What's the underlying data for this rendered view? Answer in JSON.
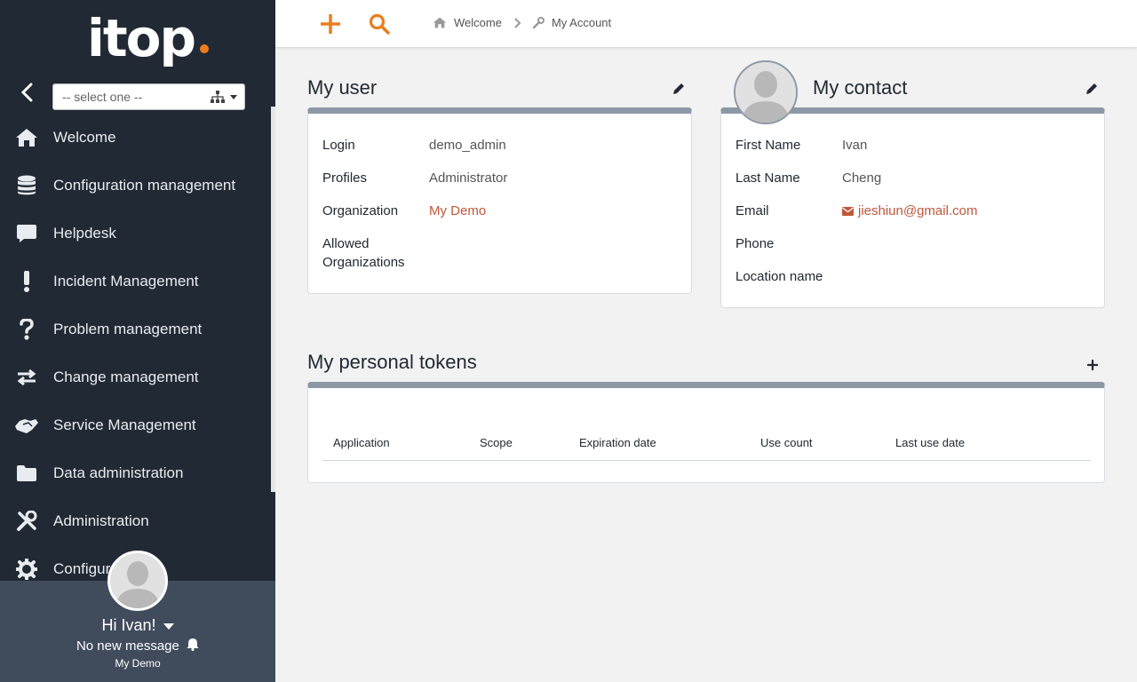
{
  "app": {
    "logo_text": "itop"
  },
  "sidebar": {
    "org_select": {
      "placeholder": "-- select one --"
    },
    "items": [
      {
        "label": "Welcome",
        "icon": "home-icon"
      },
      {
        "label": "Configuration management",
        "icon": "database-icon"
      },
      {
        "label": "Helpdesk",
        "icon": "comment-icon"
      },
      {
        "label": "Incident Management",
        "icon": "exclamation-icon"
      },
      {
        "label": "Problem management",
        "icon": "question-icon"
      },
      {
        "label": "Change management",
        "icon": "exchange-icon"
      },
      {
        "label": "Service Management",
        "icon": "handshake-icon"
      },
      {
        "label": "Data administration",
        "icon": "folder-icon"
      },
      {
        "label": "Administration",
        "icon": "tools-icon"
      },
      {
        "label": "Configur",
        "icon": "gear-icon"
      }
    ],
    "user": {
      "greeting": "Hi Ivan!",
      "messages": "No new message",
      "organization": "My Demo"
    }
  },
  "topbar": {
    "breadcrumb": [
      {
        "label": "Welcome",
        "icon": "home-icon"
      },
      {
        "label": "My Account",
        "icon": "wrench-icon"
      }
    ]
  },
  "my_user": {
    "title": "My user",
    "fields": [
      {
        "label": "Login",
        "value": "demo_admin"
      },
      {
        "label": "Profiles",
        "value": "Administrator"
      },
      {
        "label": "Organization",
        "value": "My Demo"
      },
      {
        "label_line1": "Allowed",
        "label_line2": "Organizations",
        "value": ""
      }
    ]
  },
  "my_contact": {
    "title": "My contact",
    "fields": [
      {
        "label": "First Name",
        "value": "Ivan"
      },
      {
        "label": "Last Name",
        "value": "Cheng"
      },
      {
        "label": "Email",
        "value": "jieshiun@gmail.com"
      },
      {
        "label": "Phone",
        "value": ""
      },
      {
        "label": "Location name",
        "value": ""
      }
    ]
  },
  "tokens": {
    "title": "My personal tokens",
    "columns": [
      "Application",
      "Scope",
      "Expiration date",
      "Use count",
      "Last use date"
    ],
    "rows": []
  },
  "colors": {
    "sidebar_bg": "#212934",
    "user_panel_bg": "#404c5c",
    "accent": "#ea7d1e",
    "link": "#c0573b",
    "card_header": "#8d98a6"
  }
}
